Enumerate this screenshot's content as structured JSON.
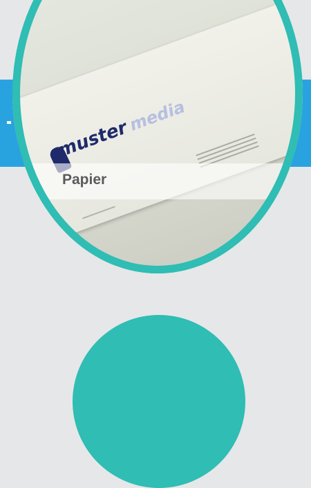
{
  "gallery": {
    "item": {
      "caption": "Papier",
      "logo_text_primary": "muster",
      "logo_text_secondary": "media"
    }
  },
  "colors": {
    "background": "#e6e7e9",
    "accent_blue": "#29a3df",
    "ring_teal": "#2fbdb4"
  }
}
